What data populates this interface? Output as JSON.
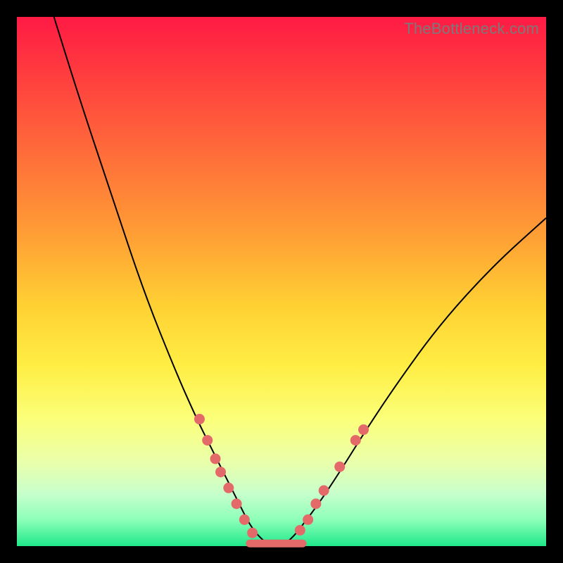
{
  "watermark": "TheBottleneck.com",
  "colors": {
    "frame_border": "#000000",
    "curve": "#000000",
    "marker": "#e46a6a",
    "gradient_top": "#ff1a44",
    "gradient_bottom": "#1fe88a"
  },
  "chart_data": {
    "type": "line",
    "title": "",
    "xlabel": "",
    "ylabel": "",
    "xlim": [
      0,
      100
    ],
    "ylim": [
      0,
      100
    ],
    "grid": false,
    "series": [
      {
        "name": "bottleneck-curve",
        "comment": "V-shaped curve; valley near x≈48, y≈0; left arm reaches top-left, right arm rises toward right edge at ~62% height",
        "x": [
          7,
          12,
          18,
          24,
          30,
          34,
          37,
          40,
          42,
          44,
          46,
          48,
          50,
          52,
          54,
          57,
          61,
          66,
          72,
          80,
          90,
          100
        ],
        "y": [
          100,
          84,
          66,
          48,
          33,
          24,
          18,
          12,
          8,
          4,
          1.5,
          0,
          0,
          1.5,
          4,
          8,
          14,
          22,
          31,
          42,
          53,
          62
        ]
      }
    ],
    "highlight_segment": {
      "comment": "Flat salmon segment along the valley floor",
      "x": [
        44,
        54
      ],
      "y": [
        0.5,
        0.5
      ]
    },
    "markers": {
      "comment": "Salmon dots along the lower flanks of the V",
      "points": [
        {
          "x": 34.5,
          "y": 24
        },
        {
          "x": 36.0,
          "y": 20
        },
        {
          "x": 37.5,
          "y": 16.5
        },
        {
          "x": 38.5,
          "y": 14
        },
        {
          "x": 40.0,
          "y": 11
        },
        {
          "x": 41.5,
          "y": 8
        },
        {
          "x": 43.0,
          "y": 5
        },
        {
          "x": 44.5,
          "y": 2.5
        },
        {
          "x": 53.5,
          "y": 3
        },
        {
          "x": 55.0,
          "y": 5
        },
        {
          "x": 56.5,
          "y": 8
        },
        {
          "x": 58.0,
          "y": 10.5
        },
        {
          "x": 61.0,
          "y": 15
        },
        {
          "x": 64.0,
          "y": 20
        },
        {
          "x": 65.5,
          "y": 22
        }
      ]
    }
  }
}
